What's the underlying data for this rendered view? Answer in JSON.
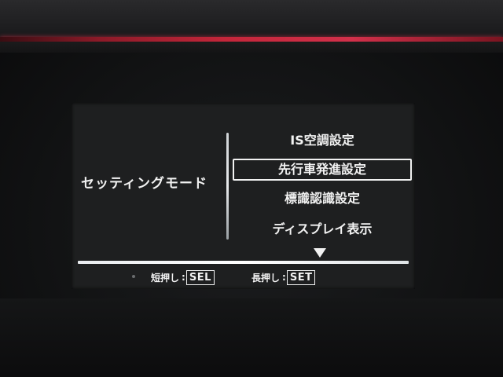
{
  "settings_screen": {
    "mode_title": "セッティングモード",
    "menu_items": [
      {
        "label": "IS空調設定",
        "selected": false
      },
      {
        "label": "先行車発進設定",
        "selected": true
      },
      {
        "label": "標識認識設定",
        "selected": false
      },
      {
        "label": "ディスプレイ表示",
        "selected": false
      }
    ],
    "more_icon": "triangle-down-icon",
    "hints": {
      "short_press": {
        "label": "短押し",
        "colon": ":",
        "key": "SEL"
      },
      "long_press": {
        "label": "長押し",
        "colon": ":",
        "key": "SET"
      }
    }
  },
  "colors": {
    "accent_red": "#d2304a",
    "text": "#f2f2f2",
    "panel_background": "#1e1f20"
  }
}
